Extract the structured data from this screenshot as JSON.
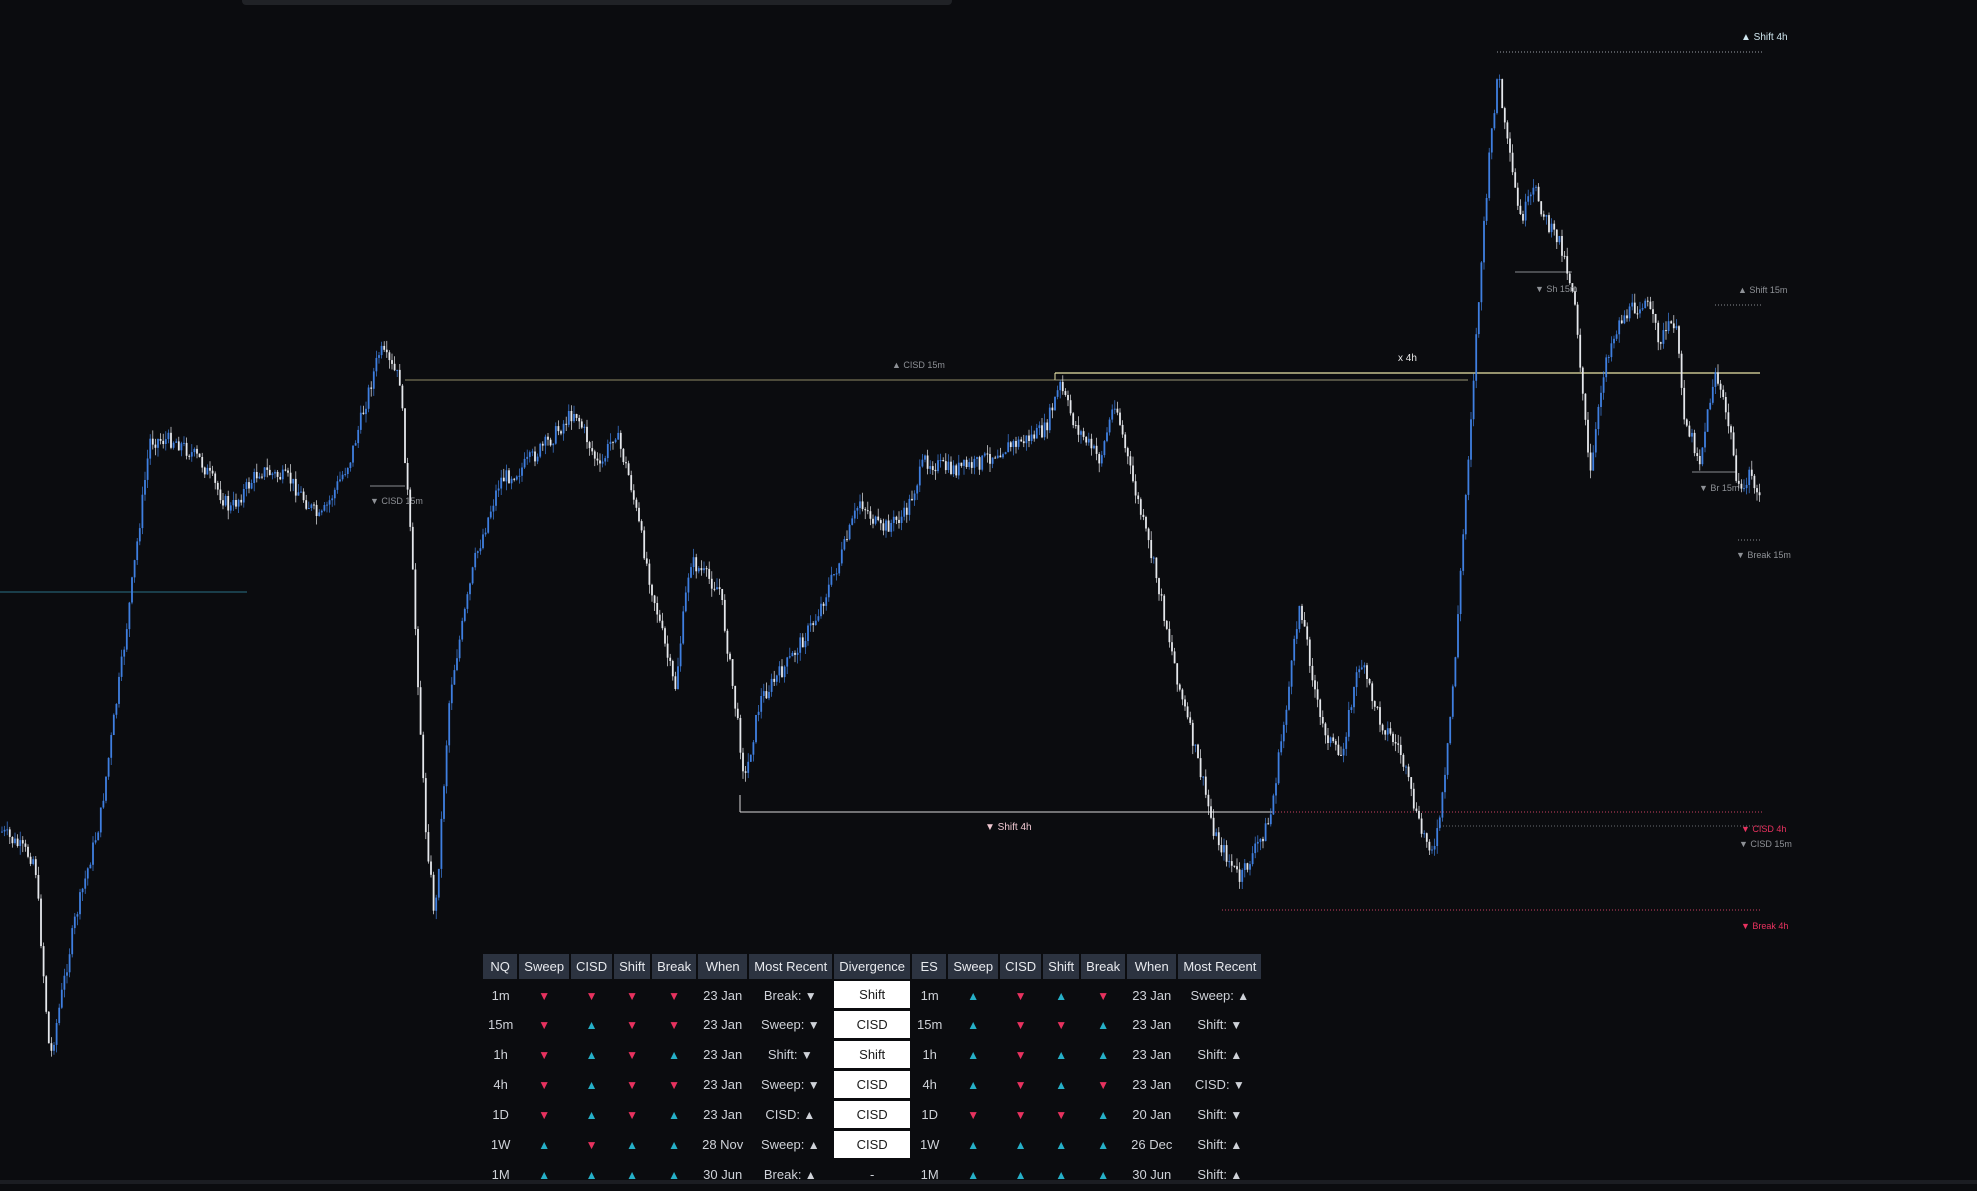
{
  "colors": {
    "bull": "#26b0c8",
    "bear": "#e8325f",
    "candle_up": "#3f7fe0",
    "candle_down": "#e6e8ec",
    "level_yellow": "#e9e4a8",
    "level_white": "#d8d8d8",
    "level_red": "#c84060",
    "level_cyan": "#2a6f86"
  },
  "chart_labels": {
    "shift_4h_top": "▲ Shift 4h",
    "shift_15m_right": "▲ Shift 15m",
    "sh_15m": "▼ Sh 15m",
    "cisd_15m_top": "▲ CISD 15m",
    "x_4h": "x 4h",
    "cisd_15m_left": "▼ CISD 15m",
    "br_15m": "▼ Br 15m",
    "break_15m": "▼ Break 15m",
    "shift_4h_bottom": "▼ Shift 4h",
    "cisd_4h": "▼ CISD 4h",
    "cisd_15m_bottom": "▼ CISD 15m",
    "break_4h": "▼ Break 4h"
  },
  "table": {
    "headers": [
      "NQ",
      "Sweep",
      "CISD",
      "Shift",
      "Break",
      "When",
      "Most Recent",
      "Divergence",
      "ES",
      "Sweep",
      "CISD",
      "Shift",
      "Break",
      "When",
      "Most Recent"
    ],
    "rows": [
      {
        "nq_tf": "1m",
        "nq_sweep": "down",
        "nq_cisd": "down",
        "nq_shift": "down",
        "nq_break": "down",
        "nq_when": "23 Jan",
        "nq_recent_label": "Break:",
        "nq_recent_dir": "down",
        "divergence": "Shift",
        "es_tf": "1m",
        "es_sweep": "up",
        "es_cisd": "down",
        "es_shift": "up",
        "es_break": "down",
        "es_when": "23 Jan",
        "es_recent_label": "Sweep:",
        "es_recent_dir": "up"
      },
      {
        "nq_tf": "15m",
        "nq_sweep": "down",
        "nq_cisd": "up",
        "nq_shift": "down",
        "nq_break": "down",
        "nq_when": "23 Jan",
        "nq_recent_label": "Sweep:",
        "nq_recent_dir": "down",
        "divergence": "CISD",
        "es_tf": "15m",
        "es_sweep": "up",
        "es_cisd": "down",
        "es_shift": "down",
        "es_break": "up",
        "es_when": "23 Jan",
        "es_recent_label": "Shift:",
        "es_recent_dir": "down"
      },
      {
        "nq_tf": "1h",
        "nq_sweep": "down",
        "nq_cisd": "up",
        "nq_shift": "down",
        "nq_break": "up",
        "nq_when": "23 Jan",
        "nq_recent_label": "Shift:",
        "nq_recent_dir": "down",
        "divergence": "Shift",
        "es_tf": "1h",
        "es_sweep": "up",
        "es_cisd": "down",
        "es_shift": "up",
        "es_break": "up",
        "es_when": "23 Jan",
        "es_recent_label": "Shift:",
        "es_recent_dir": "up"
      },
      {
        "nq_tf": "4h",
        "nq_sweep": "down",
        "nq_cisd": "up",
        "nq_shift": "down",
        "nq_break": "down",
        "nq_when": "23 Jan",
        "nq_recent_label": "Sweep:",
        "nq_recent_dir": "down",
        "divergence": "CISD",
        "es_tf": "4h",
        "es_sweep": "up",
        "es_cisd": "down",
        "es_shift": "up",
        "es_break": "down",
        "es_when": "23 Jan",
        "es_recent_label": "CISD:",
        "es_recent_dir": "down"
      },
      {
        "nq_tf": "1D",
        "nq_sweep": "down",
        "nq_cisd": "up",
        "nq_shift": "down",
        "nq_break": "up",
        "nq_when": "23 Jan",
        "nq_recent_label": "CISD:",
        "nq_recent_dir": "up",
        "divergence": "CISD",
        "es_tf": "1D",
        "es_sweep": "down",
        "es_cisd": "down",
        "es_shift": "down",
        "es_break": "up",
        "es_when": "20 Jan",
        "es_recent_label": "Shift:",
        "es_recent_dir": "down"
      },
      {
        "nq_tf": "1W",
        "nq_sweep": "up",
        "nq_cisd": "down",
        "nq_shift": "up",
        "nq_break": "up",
        "nq_when": "28 Nov",
        "nq_recent_label": "Sweep:",
        "nq_recent_dir": "up",
        "divergence": "CISD",
        "es_tf": "1W",
        "es_sweep": "up",
        "es_cisd": "up",
        "es_shift": "up",
        "es_break": "up",
        "es_when": "26 Dec",
        "es_recent_label": "Shift:",
        "es_recent_dir": "up"
      },
      {
        "nq_tf": "1M",
        "nq_sweep": "up",
        "nq_cisd": "up",
        "nq_shift": "up",
        "nq_break": "up",
        "nq_when": "30 Jun",
        "nq_recent_label": "Break:",
        "nq_recent_dir": "up",
        "divergence": "-",
        "es_tf": "1M",
        "es_sweep": "up",
        "es_cisd": "up",
        "es_shift": "up",
        "es_break": "up",
        "es_when": "30 Jun",
        "es_recent_label": "Shift:",
        "es_recent_dir": "up"
      }
    ]
  }
}
